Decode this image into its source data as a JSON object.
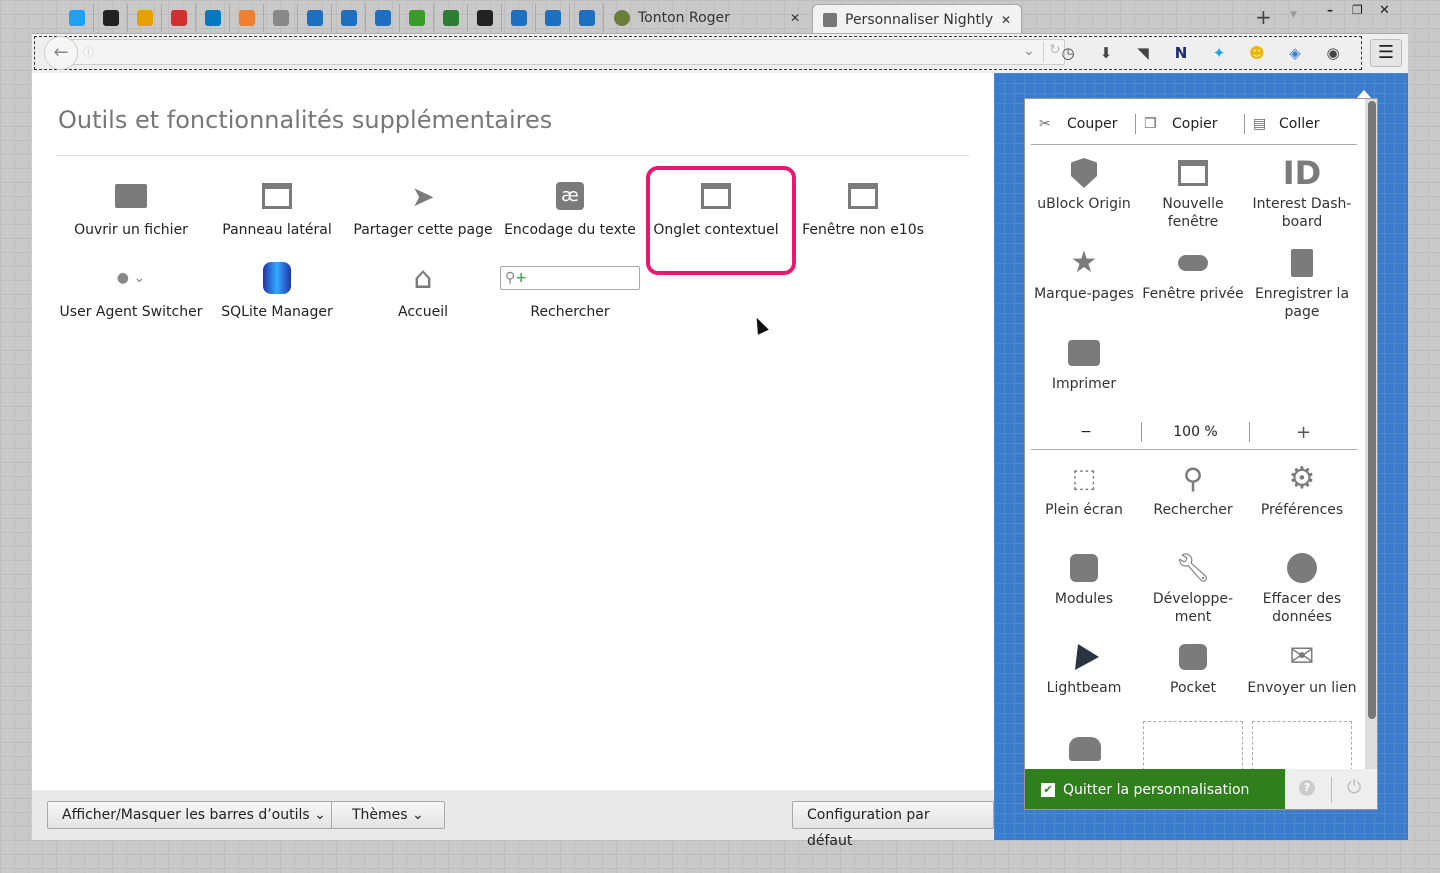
{
  "tabs": {
    "pinned": [
      {
        "icon": "twitter-icon",
        "color": "#1da1f2"
      },
      {
        "icon": "app-icon",
        "color": "#222222"
      },
      {
        "icon": "photo-icon",
        "color": "#e8a000"
      },
      {
        "icon": "bookmarklet-icon",
        "color": "#d32f2f"
      },
      {
        "icon": "trello-icon",
        "color": "#0079bf"
      },
      {
        "icon": "play-icon",
        "color": "#f08030"
      },
      {
        "icon": "globe-icon",
        "color": "#888888"
      },
      {
        "icon": "elephant-icon",
        "color": "#1e6fc0"
      },
      {
        "icon": "elephant-icon",
        "color": "#1e6fc0"
      },
      {
        "icon": "elephant-icon",
        "color": "#1e6fc0"
      },
      {
        "icon": "bug-icon",
        "color": "#3a9a2a"
      },
      {
        "icon": "p-icon",
        "color": "#2e7d32"
      },
      {
        "icon": "github-icon",
        "color": "#222222"
      },
      {
        "icon": "elephant-icon",
        "color": "#1e6fc0"
      },
      {
        "icon": "elephant-icon",
        "color": "#1e6fc0"
      },
      {
        "icon": "elephant-icon",
        "color": "#1e6fc0"
      }
    ],
    "items": [
      {
        "label": "Tonton Roger"
      },
      {
        "label": "Personnaliser Nightly",
        "active": true
      }
    ],
    "new_tab": "+"
  },
  "main": {
    "title": "Outils et fonctionnalités supplémentaires",
    "items": [
      {
        "label": "Ouvrir un fichier",
        "icon": "folder-icon"
      },
      {
        "label": "Panneau latéral",
        "icon": "sidebar-icon"
      },
      {
        "label": "Partager cette page",
        "icon": "share-icon"
      },
      {
        "label": "Encodage du texte",
        "icon": "text-encoding-icon",
        "glyph": "æ"
      },
      {
        "label": "Onglet contextuel",
        "icon": "container-tab-icon",
        "highlighted": true
      },
      {
        "label": "Fenêtre non e10s",
        "icon": "window-icon"
      },
      {
        "label": "User Agent Switcher",
        "icon": "user-agent-icon"
      },
      {
        "label": "SQLite Manager",
        "icon": "database-icon"
      },
      {
        "label": "Accueil",
        "icon": "home-icon"
      },
      {
        "label": "Rechercher",
        "icon": "search-box"
      }
    ],
    "buttons": {
      "toolbars": "Afficher/Masquer les barres d’outils",
      "themes": "Thèmes",
      "restore": "Configuration par défaut"
    }
  },
  "panel": {
    "edit": {
      "cut": "Couper",
      "copy": "Copier",
      "paste": "Coller"
    },
    "zoom": {
      "minus": "−",
      "value": "100 %",
      "plus": "+"
    },
    "items_top": [
      {
        "label": "uBlock Origin",
        "icon": "ublock-icon"
      },
      {
        "label": "Nouvelle fenêtre",
        "icon": "new-window-icon"
      },
      {
        "label": "Interest Dash-board",
        "icon": "interest-dashboard-icon",
        "glyph": "ID"
      },
      {
        "label": "Marque-pages",
        "icon": "star-icon"
      },
      {
        "label": "Fenêtre privée",
        "icon": "mask-icon"
      },
      {
        "label": "Enregistrer la page",
        "icon": "save-page-icon"
      },
      {
        "label": "Imprimer",
        "icon": "print-icon"
      }
    ],
    "items_bottom": [
      {
        "label": "Plein écran",
        "icon": "fullscreen-icon"
      },
      {
        "label": "Rechercher",
        "icon": "search-icon"
      },
      {
        "label": "Préférences",
        "icon": "gear-icon"
      },
      {
        "label": "Modules",
        "icon": "puzzle-icon"
      },
      {
        "label": "Développe-ment",
        "icon": "wrench-icon"
      },
      {
        "label": "Effacer des données",
        "icon": "forget-icon"
      },
      {
        "label": "Lightbeam",
        "icon": "lightbeam-icon"
      },
      {
        "label": "Pocket",
        "icon": "pocket-icon"
      },
      {
        "label": "Envoyer un lien",
        "icon": "email-icon"
      }
    ],
    "quit": "Quitter la personnalisation"
  }
}
